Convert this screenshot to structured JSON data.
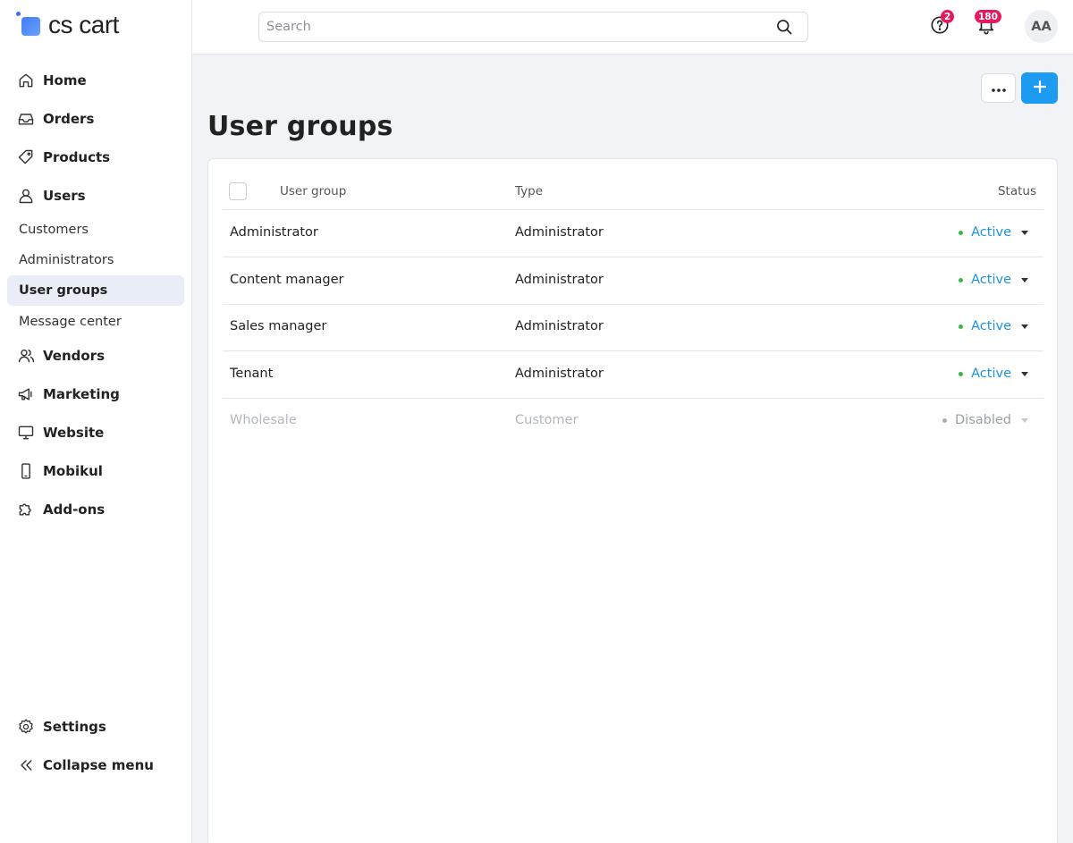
{
  "brand": {
    "name": "cs cart"
  },
  "sidebar": {
    "items": [
      {
        "label": "Home",
        "icon": "home-icon"
      },
      {
        "label": "Orders",
        "icon": "inbox-icon"
      },
      {
        "label": "Products",
        "icon": "tag-icon"
      },
      {
        "label": "Users",
        "icon": "user-icon"
      },
      {
        "label": "Vendors",
        "icon": "users-icon"
      },
      {
        "label": "Marketing",
        "icon": "megaphone-icon"
      },
      {
        "label": "Website",
        "icon": "monitor-icon"
      },
      {
        "label": "Mobikul",
        "icon": "smartphone-icon"
      },
      {
        "label": "Add-ons",
        "icon": "puzzle-icon"
      }
    ],
    "users_submenu": [
      "Customers",
      "Administrators",
      "User groups",
      "Message center"
    ],
    "active_submenu": "User groups",
    "footer": [
      {
        "label": "Settings",
        "icon": "gear-icon"
      },
      {
        "label": "Collapse menu",
        "icon": "chevrons-left-icon"
      }
    ]
  },
  "topbar": {
    "search_placeholder": "Search",
    "help_badge": "2",
    "notifications_badge": "180",
    "avatar_initials": "AA"
  },
  "page": {
    "title": "User groups",
    "table": {
      "columns": [
        "User group",
        "Type",
        "Status"
      ],
      "rows": [
        {
          "name": "Administrator",
          "type": "Administrator",
          "status": "Active"
        },
        {
          "name": "Content manager",
          "type": "Administrator",
          "status": "Active"
        },
        {
          "name": "Sales manager",
          "type": "Administrator",
          "status": "Active"
        },
        {
          "name": "Tenant",
          "type": "Administrator",
          "status": "Active"
        },
        {
          "name": "Wholesale",
          "type": "Customer",
          "status": "Disabled"
        }
      ]
    }
  },
  "colors": {
    "accent": "#1c9bf0",
    "active_status": "#1b93e5",
    "active_dot": "#3db64a",
    "badge": "#e5195f"
  }
}
